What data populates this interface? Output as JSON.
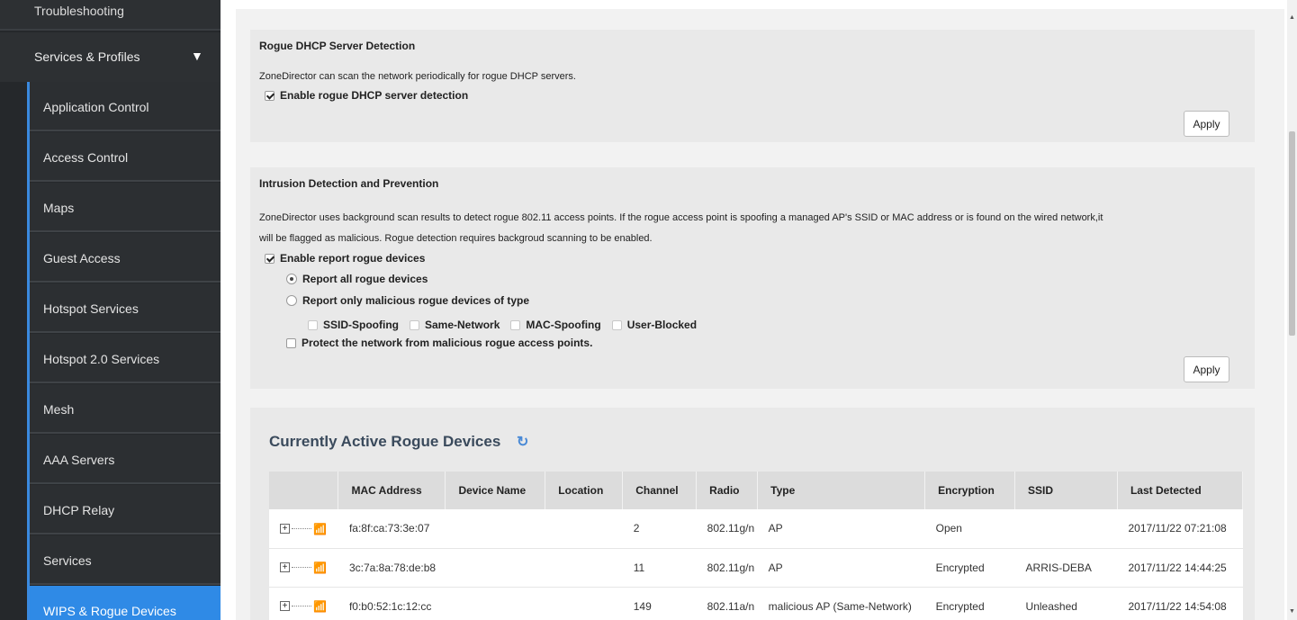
{
  "sidebar": {
    "top_item": "Troubleshooting",
    "section_header": "Services & Profiles",
    "items": [
      {
        "label": "Application Control"
      },
      {
        "label": "Access Control"
      },
      {
        "label": "Maps"
      },
      {
        "label": "Guest Access"
      },
      {
        "label": "Hotspot Services"
      },
      {
        "label": "Hotspot 2.0 Services"
      },
      {
        "label": "Mesh"
      },
      {
        "label": "AAA Servers"
      },
      {
        "label": "DHCP Relay"
      },
      {
        "label": "Services"
      },
      {
        "label": "WIPS & Rogue Devices"
      }
    ],
    "active_item": "WIPS & Rogue Devices"
  },
  "dhcp": {
    "title": "Rogue DHCP Server Detection",
    "description": "ZoneDirector can scan the network periodically for rogue DHCP servers.",
    "enable_label": "Enable rogue DHCP server detection",
    "enable_checked": true,
    "apply_label": "Apply"
  },
  "idp": {
    "title": "Intrusion Detection and Prevention",
    "description_line1": "ZoneDirector uses background scan results to detect rogue 802.11 access points. If the rogue access point is spoofing a managed AP's SSID or MAC address or is found on the wired network,it",
    "description_line2": "will be flagged as malicious. Rogue detection requires backgroud scanning to be enabled.",
    "enable_report_label": "Enable report rogue devices",
    "enable_report_checked": true,
    "report_all_label": "Report all rogue devices",
    "report_all_selected": true,
    "report_malicious_label": "Report only malicious rogue devices of type",
    "types": [
      "SSID-Spoofing",
      "Same-Network",
      "MAC-Spoofing",
      "User-Blocked"
    ],
    "protect_label": "Protect the network from malicious rogue access points.",
    "protect_checked": false,
    "apply_label": "Apply"
  },
  "rogue": {
    "title": "Currently Active Rogue Devices",
    "refresh_icon": "refresh-icon",
    "columns": [
      "MAC Address",
      "Device Name",
      "Location",
      "Channel",
      "Radio",
      "Type",
      "Encryption",
      "SSID",
      "Last Detected"
    ],
    "rows": [
      {
        "mac": "fa:8f:ca:73:3e:07",
        "device_name": "",
        "location": "",
        "channel": "2",
        "radio": "802.11g/n",
        "type": "AP",
        "encryption": "Open",
        "ssid": "",
        "last_detected": "2017/11/22  07:21:08"
      },
      {
        "mac": "3c:7a:8a:78:de:b8",
        "device_name": "",
        "location": "",
        "channel": "11",
        "radio": "802.11g/n",
        "type": "AP",
        "encryption": "Encrypted",
        "ssid": "ARRIS-DEBA",
        "last_detected": "2017/11/22  14:44:25"
      },
      {
        "mac": "f0:b0:52:1c:12:cc",
        "device_name": "",
        "location": "",
        "channel": "149",
        "radio": "802.11a/n",
        "type": "malicious AP (Same-Network)",
        "encryption": "Encrypted",
        "ssid": "Unleashed",
        "last_detected": "2017/11/22  14:54:08"
      }
    ]
  },
  "colors": {
    "sidebar_bg": "#25282b",
    "active_item": "#2f8ae6",
    "panel_bg": "#e9e9e9",
    "table_header": "#dcdcdc"
  }
}
